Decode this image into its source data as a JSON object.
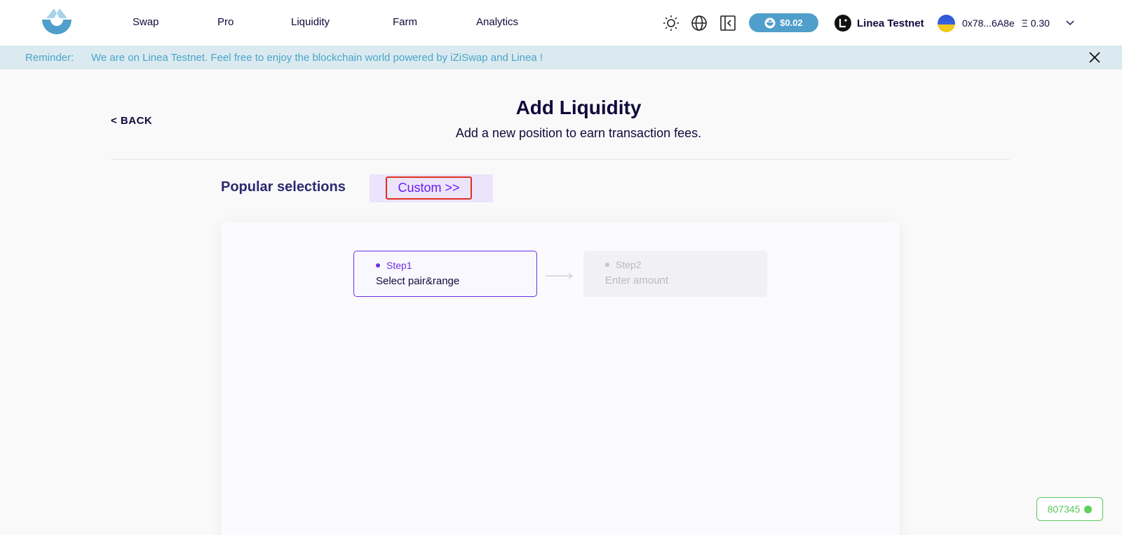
{
  "header": {
    "nav": [
      "Swap",
      "Pro",
      "Liquidity",
      "Farm",
      "Analytics"
    ],
    "price": "$0.02",
    "network": "Linea Testnet",
    "account": "0x78...6A8e",
    "balance": "Ξ 0.30"
  },
  "reminder": {
    "label": "Reminder:",
    "text": "We are on Linea Testnet. Feel free to enjoy the blockchain world powered by iZiSwap and Linea !"
  },
  "page": {
    "back_label": "< BACK",
    "title": "Add Liquidity",
    "subtitle": "Add a new position to earn transaction fees.",
    "popular_label": "Popular selections",
    "custom_label": "Custom >>"
  },
  "steps": [
    {
      "head": "Step1",
      "body": "Select pair&range"
    },
    {
      "head": "Step2",
      "body": "Enter amount"
    }
  ],
  "block_number": "807345",
  "colors": {
    "accent": "#6a31e0",
    "brand_blue": "#4f9fca",
    "status_green": "#5ac85a"
  }
}
